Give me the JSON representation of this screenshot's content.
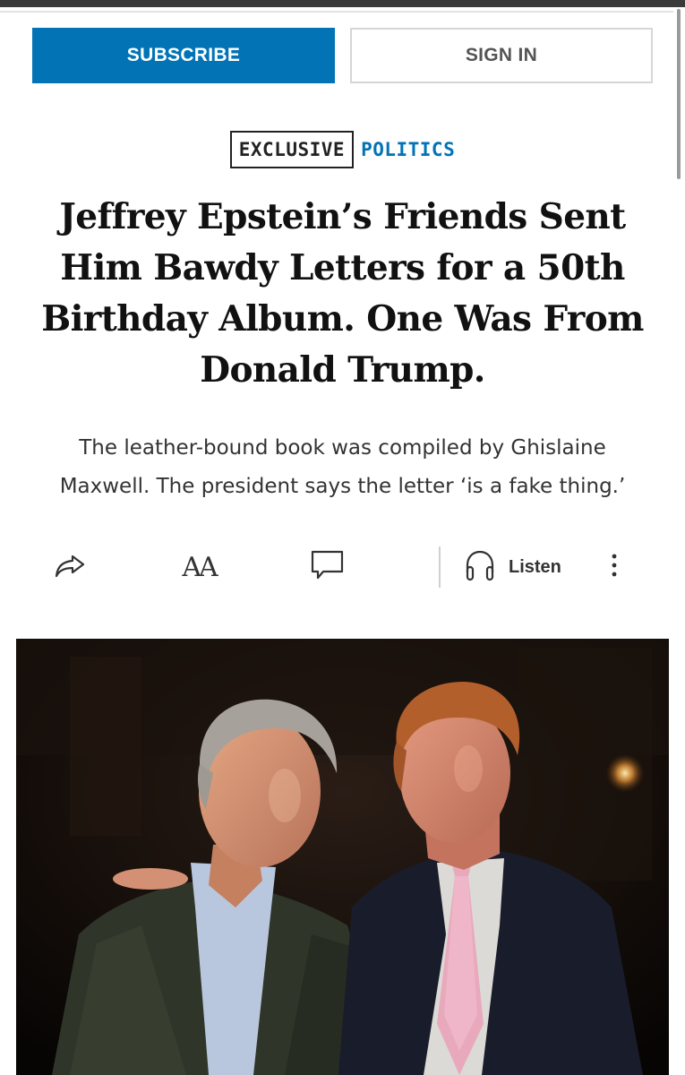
{
  "header": {
    "subscribe_label": "SUBSCRIBE",
    "signin_label": "SIGN IN"
  },
  "tags": {
    "exclusive": "EXCLUSIVE",
    "section": "POLITICS"
  },
  "article": {
    "headline": "Jeffrey Epstein’s Friends Sent Him Bawdy Letters for a 50th Birthday Album. One Was From Donald Trump.",
    "dek": "The leather-bound book was compiled by Ghislaine Maxwell. The president says the letter ‘is a fake thing.’"
  },
  "toolbar": {
    "share_icon": "share-icon",
    "text_size_icon": "text-size-icon",
    "text_size_glyph": "AA",
    "comment_icon": "comment-icon",
    "listen_icon": "headphones-icon",
    "listen_label": "Listen",
    "more_icon": "more-vertical-icon"
  },
  "colors": {
    "accent": "#0274b6",
    "headline": "#111111",
    "dek": "#333333"
  }
}
